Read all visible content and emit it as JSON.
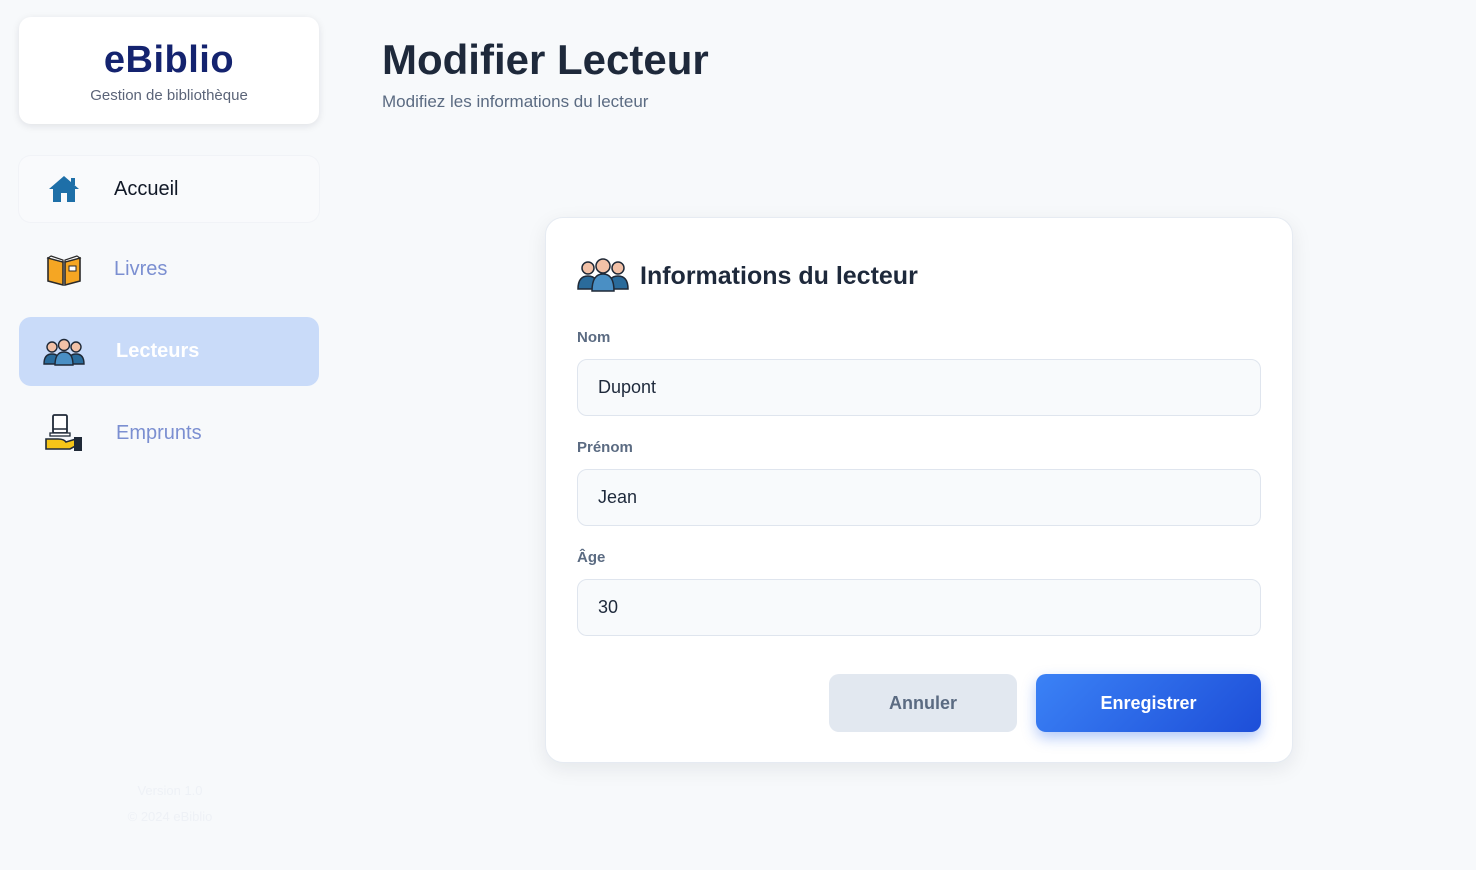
{
  "brand": {
    "name": "eBiblio",
    "subtitle": "Gestion de bibliothèque"
  },
  "nav": [
    {
      "label": "Accueil",
      "icon": "home-icon",
      "active": false
    },
    {
      "label": "Livres",
      "icon": "book-icon",
      "active": false
    },
    {
      "label": "Lecteurs",
      "icon": "readers-group-icon",
      "active": true
    },
    {
      "label": "Emprunts",
      "icon": "loan-hand-book-icon",
      "active": false
    }
  ],
  "sidebar_footer": {
    "version": "Version 1.0",
    "copyright": "© 2024 eBiblio"
  },
  "header": {
    "title": "Modifier Lecteur",
    "subtitle": "Modifiez les informations du lecteur"
  },
  "card": {
    "title": "Informations du lecteur",
    "icon": "readers-group-icon",
    "fields": [
      {
        "label": "Nom",
        "value": "Dupont"
      },
      {
        "label": "Prénom",
        "value": "Jean"
      },
      {
        "label": "Âge",
        "value": "30"
      }
    ],
    "buttons": {
      "cancel": "Annuler",
      "save": "Enregistrer"
    }
  },
  "colors": {
    "background": "#f7f9fb",
    "brand": "#14236f",
    "active_nav": "#c9dbf9",
    "primary": "#2563eb",
    "muted_nav": "#7b8fd1"
  }
}
